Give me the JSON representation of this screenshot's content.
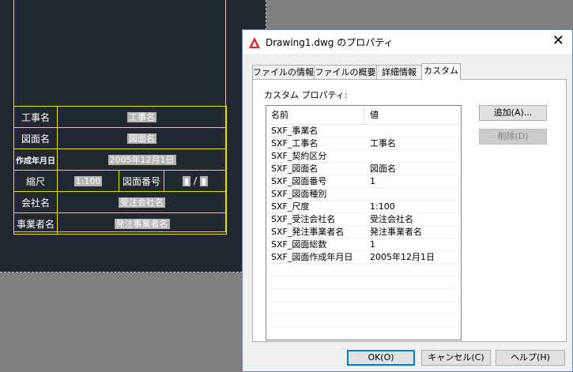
{
  "cad": {
    "rows": [
      {
        "label": "工事名",
        "value": "工事名"
      },
      {
        "label": "図面名",
        "value": "図面名"
      },
      {
        "label": "作成年月日",
        "value": "2005年12月1日"
      },
      {
        "label": "縮尺",
        "value": "1:100",
        "label2": "図面番号",
        "value2a": "▮",
        "slash": "/",
        "value2b": "▮"
      },
      {
        "label": "会社名",
        "value": "受注会社名"
      },
      {
        "label": "事業者名",
        "value": "発注事業者名"
      }
    ]
  },
  "dialog": {
    "title": "Drawing1.dwg のプロパティ",
    "close_label": "✕",
    "tabs": [
      "ファイルの情報",
      "ファイルの概要",
      "詳細情報",
      "カスタム"
    ],
    "active_tab": "カスタム",
    "panel_label": "カスタム プロパティ:",
    "columns": {
      "name": "名前",
      "value": "値"
    },
    "properties": [
      {
        "name": "SXF_事業名",
        "value": ""
      },
      {
        "name": "SXF_工事名",
        "value": "工事名"
      },
      {
        "name": "SXF_契約区分",
        "value": ""
      },
      {
        "name": "SXF_図面名",
        "value": "図面名"
      },
      {
        "name": "SXF_図面番号",
        "value": "1"
      },
      {
        "name": "SXF_図面種別",
        "value": ""
      },
      {
        "name": "SXF_尺度",
        "value": "1:100"
      },
      {
        "name": "SXF_受注会社名",
        "value": "受注会社名"
      },
      {
        "name": "SXF_発注事業者名",
        "value": "発注事業者名"
      },
      {
        "name": "SXF_図面総数",
        "value": "1"
      },
      {
        "name": "SXF_図面作成年月日",
        "value": "2005年12月1日"
      },
      {
        "name": "",
        "value": ""
      },
      {
        "name": "",
        "value": ""
      },
      {
        "name": "",
        "value": ""
      },
      {
        "name": "",
        "value": ""
      },
      {
        "name": "",
        "value": ""
      },
      {
        "name": "",
        "value": ""
      }
    ],
    "buttons": {
      "add": "追加(A)...",
      "delete": "削除(D)",
      "ok": "OK(O)",
      "cancel": "キャンセル(C)",
      "help": "ヘルプ(H)"
    },
    "colors": {
      "accent": "#0078d7",
      "cad_background": "#212830",
      "frame": "#e8e000"
    }
  }
}
